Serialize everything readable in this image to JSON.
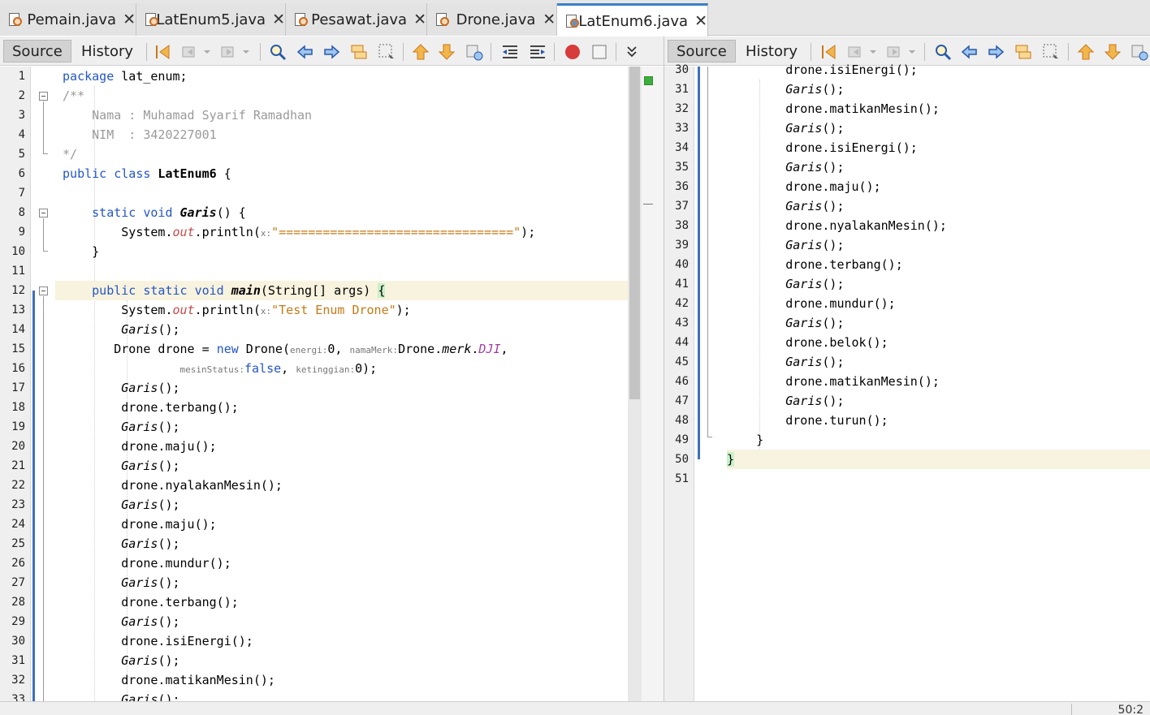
{
  "tabs": [
    {
      "label": "Pemain.java",
      "active": false
    },
    {
      "label": "LatEnum5.java",
      "active": false
    },
    {
      "label": "Pesawat.java",
      "active": false
    },
    {
      "label": "Drone.java",
      "active": false
    },
    {
      "label": "LatEnum6.java",
      "active": true
    }
  ],
  "tab_close_glyph": "✕",
  "toolbar": {
    "source_label": "Source",
    "history_label": "History"
  },
  "icons": [
    "last-edit-icon",
    "back-icon",
    "forward-icon",
    "find-icon",
    "find-previous-icon",
    "find-next-icon",
    "toggle-highlight-icon",
    "toggle-selection-icon",
    "previous-bookmark-icon",
    "next-bookmark-icon",
    "toggle-bookmark-icon",
    "shift-left-icon",
    "shift-right-icon",
    "record-macro-icon",
    "stop-macro-icon",
    "more-icon"
  ],
  "colors": {
    "keyword": "#2456c8",
    "comment": "#9a9a9a",
    "string": "#c47a16",
    "field": "#a13ea1",
    "active_tab_accent": "#3c7fc6",
    "line_highlight": "#f8f3de"
  },
  "left_editor": {
    "line_numbers": [
      "1",
      "2",
      "3",
      "4",
      "5",
      "6",
      "7",
      "8",
      "9",
      "10",
      "11",
      "12",
      "13",
      "14",
      "15",
      "16",
      "17",
      "18",
      "19",
      "20",
      "21",
      "22",
      "23",
      "24",
      "25",
      "26",
      "27",
      "28",
      "29",
      "30",
      "31",
      "32",
      "33"
    ],
    "code": {
      "l1_kw": "package",
      "l1_rest": " lat_enum;",
      "l2": "/**",
      "l3": "    Nama : Muhamad Syarif Ramadhan",
      "l4": "    NIM  : 3420227001",
      "l5": "*/",
      "l6_kw": "public class",
      "l6_name": " LatEnum6",
      "l6_rest": " {",
      "l8_kw": "    static void ",
      "l8_name": "Garis",
      "l8_rest": "() {",
      "sys": "System.",
      "out": "out",
      "println": ".println(",
      "hint_x": "x:",
      "l9_str": "\"================================\"",
      "l9_end": ");",
      "l10": "    }",
      "l12_kw": "    public static void ",
      "l12_name": "main",
      "l12_rest": "(String[] args) ",
      "brace_open": "{",
      "l13_str": "\"Test Enum Drone\"",
      "l13_end": ");",
      "garis": "Garis",
      "call_end": "();",
      "l15_a": "        Drone drone = ",
      "l15_new": "new",
      "l15_b": " Drone(",
      "hint_energi": "energi:",
      "l15_c": "0, ",
      "hint_namamerk": "namaMerk:",
      "l15_d": "Drone.",
      "merk": "merk",
      "dot": ".",
      "dji": "DJI",
      "comma": ",",
      "hint_mesin": "mesinStatus:",
      "false_kw": "false",
      "l16_comma": ", ",
      "hint_ketinggian": "ketinggian:",
      "l16_end": "0);",
      "terbang": "drone.terbang();",
      "maju": "drone.maju();",
      "nyalakan": "drone.nyalakanMesin();",
      "mundur": "drone.mundur();",
      "isi": "drone.isiEnergi();",
      "matikan": "drone.matikanMesin();"
    }
  },
  "right_editor": {
    "line_numbers": [
      "30",
      "31",
      "32",
      "33",
      "34",
      "35",
      "36",
      "37",
      "38",
      "39",
      "40",
      "41",
      "42",
      "43",
      "44",
      "45",
      "46",
      "47",
      "48",
      "49",
      "50",
      "51"
    ],
    "code": {
      "isi": "drone.isiEnergi();",
      "garis": "Garis",
      "call_end": "();",
      "matikan": "drone.matikanMesin();",
      "maju": "drone.maju();",
      "nyalakan": "drone.nyalakanMesin();",
      "terbang": "drone.terbang();",
      "mundur": "drone.mundur();",
      "belok": "drone.belok();",
      "turun": "drone.turun();",
      "close_inner": "}",
      "close_outer": "}"
    }
  },
  "status": {
    "position": "50:2"
  }
}
